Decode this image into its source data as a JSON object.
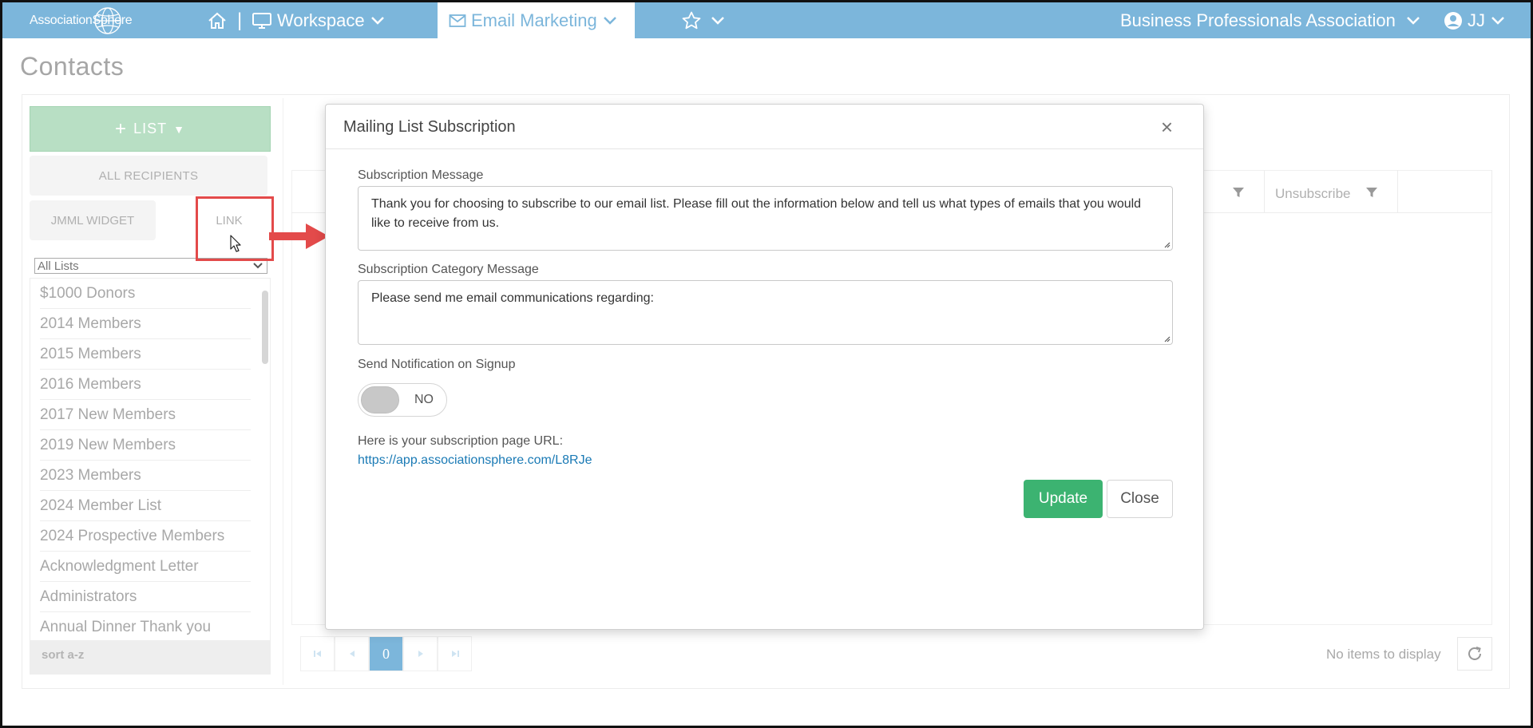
{
  "header": {
    "logo_text": "AssociationSphere",
    "workspace_label": "Workspace",
    "email_marketing_label": "Email Marketing",
    "separator": "|",
    "org_name": "Business Professionals Association",
    "user_initials": "JJ",
    "accent_color": "#7cb6db"
  },
  "page": {
    "title": "Contacts"
  },
  "sidebar": {
    "list_button_label": "LIST",
    "all_recipients_label": "ALL RECIPIENTS",
    "jmml_widget_label": "JMML WIDGET",
    "link_label": "LINK",
    "list_filter_value": "All Lists",
    "items": [
      {
        "label": "$1000 Donors"
      },
      {
        "label": "2014 Members"
      },
      {
        "label": "2015 Members"
      },
      {
        "label": "2016 Members"
      },
      {
        "label": "2017 New Members"
      },
      {
        "label": "2019 New Members"
      },
      {
        "label": "2023 Members"
      },
      {
        "label": "2024 Member List"
      },
      {
        "label": "2024 Prospective Members"
      },
      {
        "label": "Acknowledgment Letter"
      },
      {
        "label": "Administrators"
      },
      {
        "label": "Annual Dinner Thank you"
      }
    ],
    "sort_label": "sort a-z"
  },
  "grid": {
    "unsubscribe_column": "Unsubscribe",
    "pager_current": "0",
    "empty_text": "No items to display"
  },
  "modal": {
    "title": "Mailing List Subscription",
    "close_glyph": "×",
    "subscription_message_label": "Subscription Message",
    "subscription_message_value": "Thank you for choosing to subscribe to our email list. Please fill out the information below and tell us what types of emails that you would like to receive from us.",
    "category_message_label": "Subscription Category Message",
    "category_message_value": "Please send me email communications regarding:",
    "notification_label": "Send Notification on Signup",
    "notification_toggle_value": "NO",
    "url_label": "Here is your subscription page URL:",
    "url_value": "https://app.associationsphere.com/L8RJe",
    "update_button": "Update",
    "close_button": "Close",
    "update_color": "#3cb371"
  },
  "annotation": {
    "highlight_color": "#e34a4a"
  }
}
